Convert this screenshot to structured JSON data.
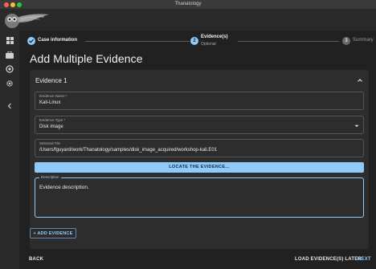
{
  "window": {
    "title": "Thanatology"
  },
  "colors": {
    "accent": "#90caf9",
    "background": "#1e1e1e",
    "card": "#2d2d2d",
    "sidebar": "#2a2a2a"
  },
  "sidebar": {
    "items": [
      {
        "icon": "dashboard-icon"
      },
      {
        "icon": "briefcase-icon"
      },
      {
        "icon": "target-icon"
      },
      {
        "icon": "gear-icon"
      },
      {
        "icon": "chevron-left-icon"
      }
    ]
  },
  "stepper": {
    "steps": [
      {
        "label": "Case information",
        "state": "completed"
      },
      {
        "number": "2",
        "label": "Evidence(s)",
        "sublabel": "Optional",
        "state": "active"
      },
      {
        "number": "3",
        "label": "Summary",
        "state": "inactive"
      }
    ]
  },
  "page": {
    "title": "Add Multiple Evidence"
  },
  "evidence": {
    "title": "Evidence 1",
    "name": {
      "label": "Evidence Name *",
      "value": "Kali-Linux"
    },
    "type": {
      "label": "Evidence Type *",
      "value": "Disk image"
    },
    "file": {
      "label": "Selected File",
      "value": "/Users/fguyard/work/Thanatology/samples/disk_image_acquired/workshop-kali.E01"
    },
    "locate_label": "LOCATE THE EVIDENCE...",
    "description": {
      "label": "Description",
      "value": "Evidence description."
    }
  },
  "actions": {
    "add_evidence": "+ ADD EVIDENCE",
    "back": "BACK",
    "load_later": "LOAD EVIDENCE(S) LATER",
    "next": "NEXT"
  }
}
